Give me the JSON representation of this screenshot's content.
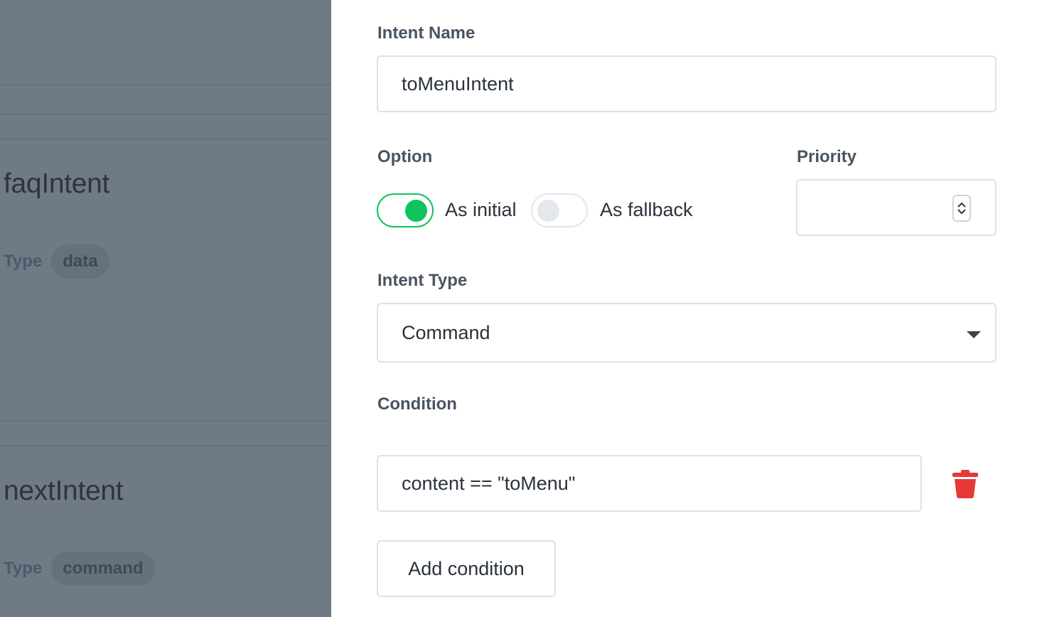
{
  "intent_list": {
    "items": [
      {
        "name": "faqIntent",
        "type_label": "Type",
        "type_value": "data"
      },
      {
        "name": "nextIntent",
        "type_label": "Type",
        "type_value": "command"
      }
    ]
  },
  "form": {
    "intent_name": {
      "label": "Intent Name",
      "value": "toMenuIntent"
    },
    "option": {
      "label": "Option",
      "as_initial": {
        "label": "As initial",
        "checked": true
      },
      "as_fallback": {
        "label": "As fallback",
        "checked": false
      }
    },
    "priority": {
      "label": "Priority",
      "value": ""
    },
    "intent_type": {
      "label": "Intent Type",
      "selected": "Command"
    },
    "condition": {
      "label": "Condition",
      "items": [
        {
          "value": "content == \"toMenu\""
        }
      ],
      "add_label": "Add condition"
    }
  },
  "colors": {
    "toggle_on": "#0fc45c",
    "delete": "#e53935",
    "overlay": "#6f7a86"
  }
}
